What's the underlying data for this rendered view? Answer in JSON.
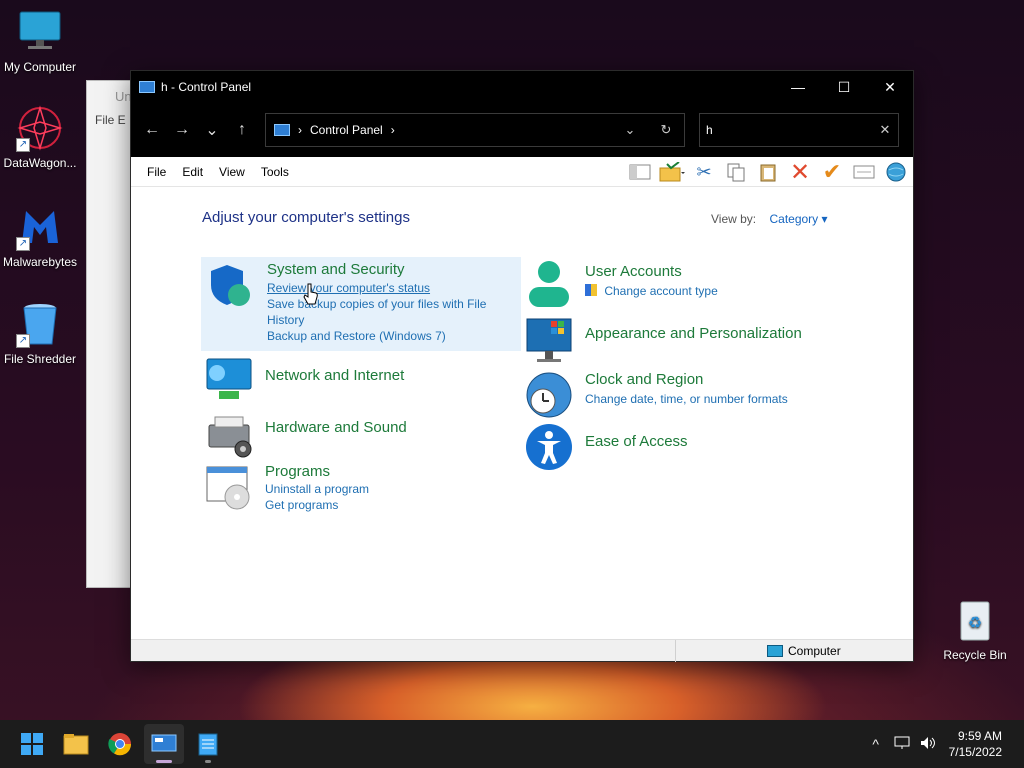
{
  "desktop": {
    "icons": [
      {
        "label": "My Computer"
      },
      {
        "label": "DataWagon..."
      },
      {
        "label": "Malwarebytes"
      },
      {
        "label": "File Shredder"
      },
      {
        "label": "Recycle Bin"
      }
    ]
  },
  "bg_window": {
    "title": "Un",
    "menu": "File  E"
  },
  "window": {
    "title": "h - Control Panel",
    "controls": {
      "minimize": "—",
      "maximize": "☐",
      "close": "✕"
    }
  },
  "nav": {
    "back": "←",
    "forward": "→",
    "recent": "⌄",
    "up": "↑",
    "address_sep1": "›",
    "address": "Control Panel",
    "address_sep2": "›",
    "dropdown": "⌄",
    "refresh": "↻",
    "search_value": "h",
    "search_clear": "✕"
  },
  "menu": {
    "file": "File",
    "edit": "Edit",
    "view": "View",
    "tools": "Tools"
  },
  "content": {
    "heading": "Adjust your computer's settings",
    "view_by_label": "View by:",
    "view_by_value": "Category ▾",
    "categories": {
      "system": {
        "title": "System and Security",
        "links": [
          "Review your computer's status",
          "Save backup copies of your files with File History",
          "Backup and Restore (Windows 7)"
        ]
      },
      "network": {
        "title": "Network and Internet"
      },
      "hardware": {
        "title": "Hardware and Sound"
      },
      "programs": {
        "title": "Programs",
        "links": [
          "Uninstall a program",
          "Get programs"
        ]
      },
      "users": {
        "title": "User Accounts",
        "links": [
          "Change account type"
        ]
      },
      "appearance": {
        "title": "Appearance and Personalization"
      },
      "clock": {
        "title": "Clock and Region",
        "links": [
          "Change date, time, or number formats"
        ]
      },
      "ease": {
        "title": "Ease of Access"
      }
    }
  },
  "status": {
    "location": "Computer"
  },
  "taskbar": {
    "tray_up": "^",
    "time": "9:59 AM",
    "date": "7/15/2022"
  },
  "colors": {
    "link": "#1f6fb2",
    "category_title": "#1d7a3a",
    "heading": "#1e3287",
    "highlight": "#e5f1fb"
  }
}
